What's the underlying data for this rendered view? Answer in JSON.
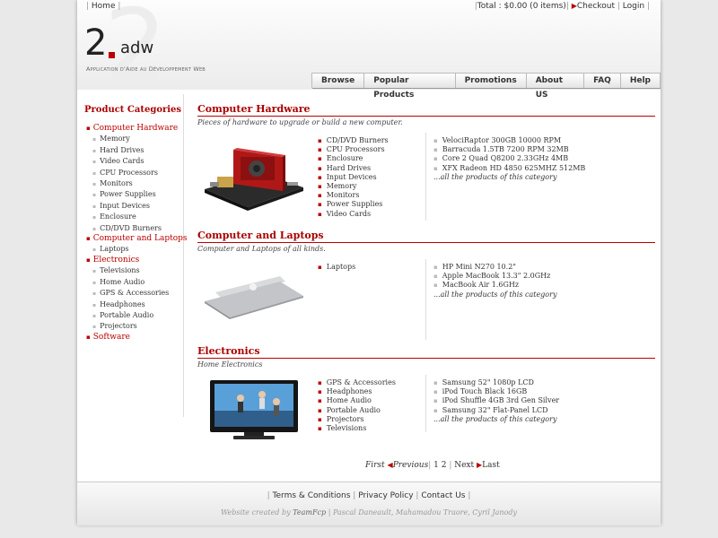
{
  "header": {
    "home": "Home",
    "total_label": "Total : $0.00 (0 items)",
    "checkout": "Checkout",
    "login": "Login",
    "logo_number": "2",
    "logo_name": "adw",
    "logo_tagline": "Application d'Aide au Développement Web"
  },
  "nav": [
    {
      "label": "Browse"
    },
    {
      "label": "Popular Products"
    },
    {
      "label": "Promotions"
    },
    {
      "label": "About US"
    },
    {
      "label": "FAQ"
    },
    {
      "label": "Help"
    }
  ],
  "sidebar": {
    "title": "Product Categories",
    "categories": [
      {
        "label": "Computer Hardware",
        "subs": [
          "Memory",
          "Hard Drives",
          "Video Cards",
          "CPU Processors",
          "Monitors",
          "Power Supplies",
          "Input Devices",
          "Enclosure",
          "CD/DVD Burners"
        ]
      },
      {
        "label": "Computer and Laptops",
        "subs": [
          "Laptops"
        ]
      },
      {
        "label": "Electronics",
        "subs": [
          "Televisions",
          "Home Audio",
          "GPS & Accessories",
          "Headphones",
          "Portable Audio",
          "Projectors"
        ]
      },
      {
        "label": "Software",
        "subs": []
      }
    ]
  },
  "sections": [
    {
      "title": "Computer Hardware",
      "desc": "Pieces of hardware to upgrade or build a new computer.",
      "links": [
        "CD/DVD Burners",
        "CPU Processors",
        "Enclosure",
        "Hard Drives",
        "Input Devices",
        "Memory",
        "Monitors",
        "Power Supplies",
        "Video Cards"
      ],
      "products": [
        "VelociRaptor 300GB 10000 RPM",
        "Barracuda 1.5TB 7200 RPM 32MB",
        "Core 2 Quad Q8200 2.33GHz 4MB",
        "XFX Radeon HD 4850 625MHZ 512MB"
      ],
      "all": "...all the products of this category"
    },
    {
      "title": "Computer and Laptops",
      "desc": "Computer and Laptops of all kinds.",
      "links": [
        "Laptops"
      ],
      "products": [
        "HP Mini N270 10.2\"",
        "Apple MacBook 13.3\" 2.0GHz",
        "MacBook Air 1.6GHz"
      ],
      "all": "...all the products of this category"
    },
    {
      "title": "Electronics",
      "desc": "Home Electronics",
      "links": [
        "GPS & Accessories",
        "Headphones",
        "Home Audio",
        "Portable Audio",
        "Projectors",
        "Televisions"
      ],
      "products": [
        "Samsung 52\" 1080p LCD",
        "iPod Touch Black 16GB",
        "iPod Shuffle 4GB 3rd Gen Silver",
        "Samsung 32\" Flat-Panel LCD"
      ],
      "all": "...all the products of this category"
    }
  ],
  "pager": {
    "first": "First",
    "previous": "Previous",
    "pages": [
      "1",
      "2"
    ],
    "next": "Next",
    "last": "Last"
  },
  "footer": {
    "links": [
      "Terms & Conditions",
      "Privacy Policy",
      "Contact Us"
    ],
    "credit_prefix": "Website created by",
    "credit_team": "TeamFcp",
    "credit_names": "Pascal Daneault, Mahamadou Traore, Cyril Janody"
  },
  "colors": {
    "accent": "#b00000",
    "background": "#e9e9e9"
  }
}
